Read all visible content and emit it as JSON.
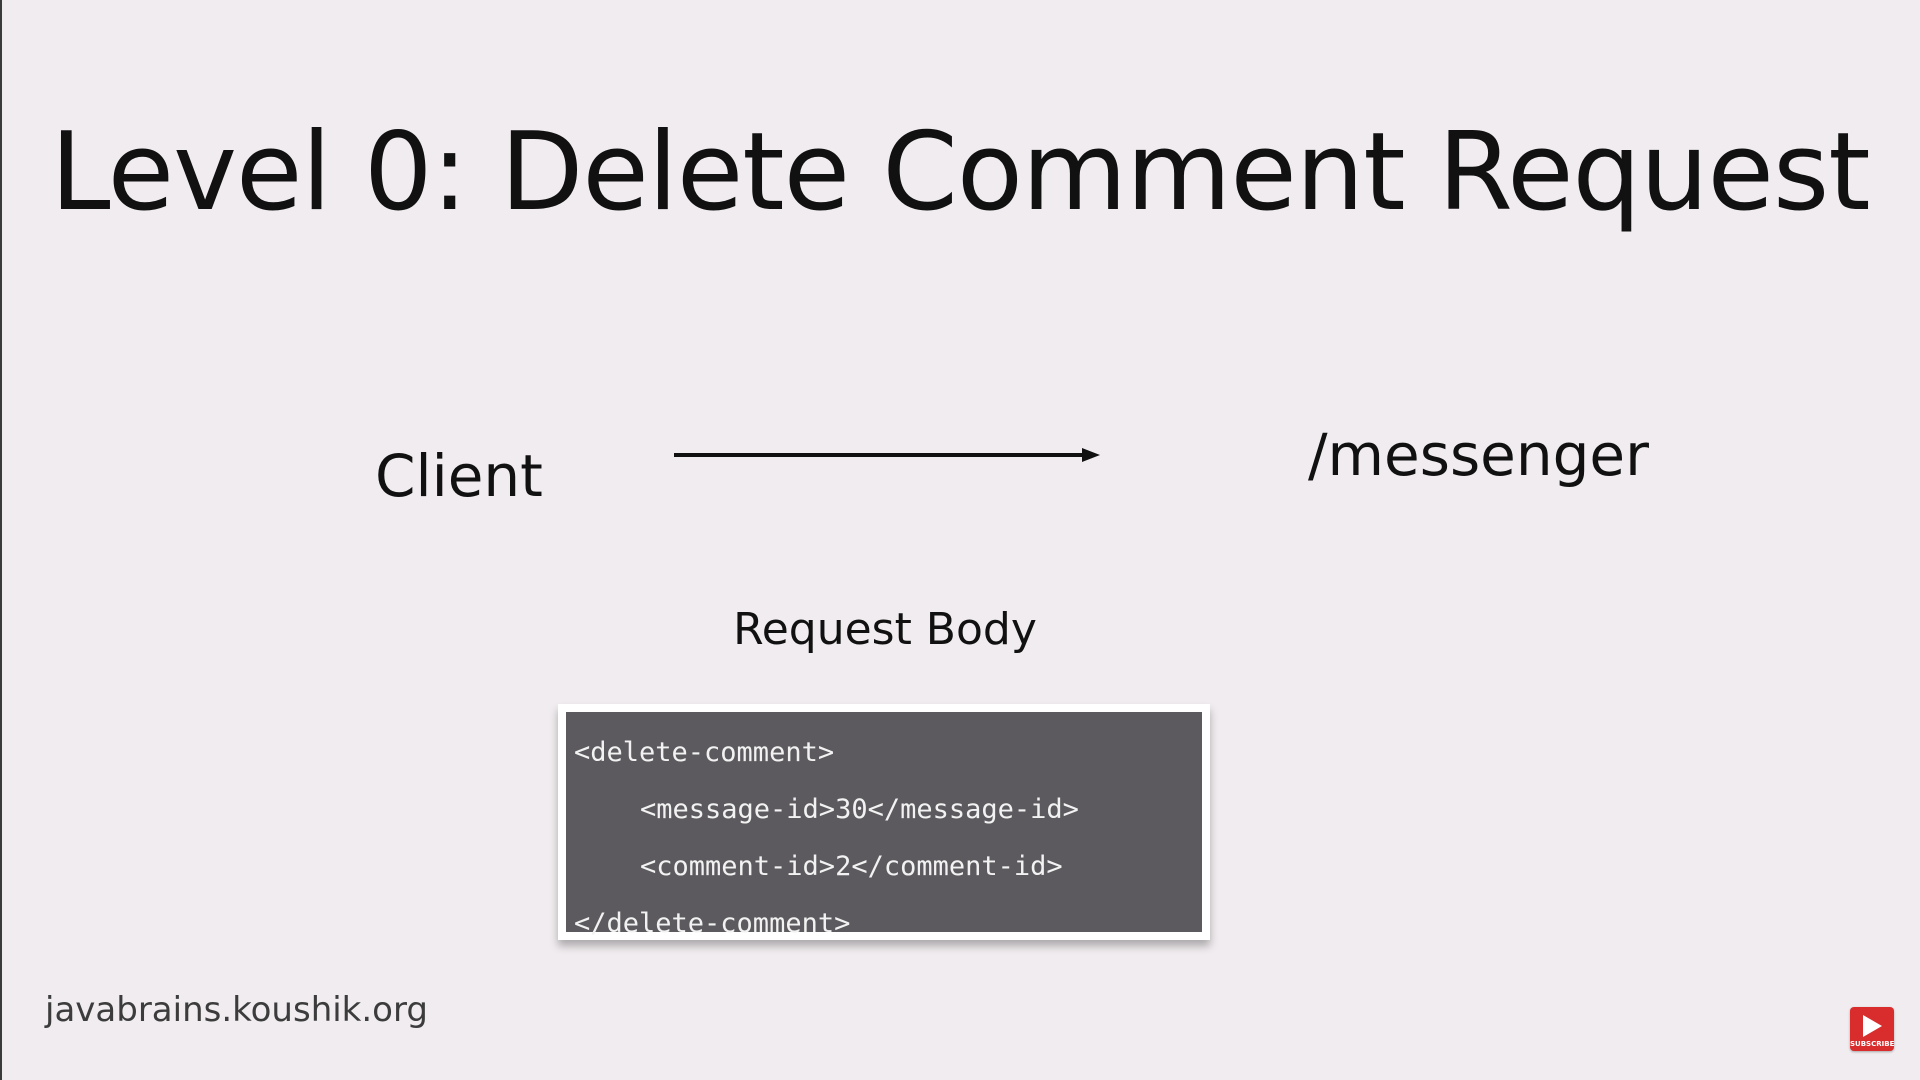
{
  "slide": {
    "title": "Level 0: Delete Comment Request",
    "client_label": "Client",
    "endpoint_label": "/messenger",
    "request_body_label": "Request Body",
    "code_lines": [
      "<delete-comment>",
      "<message-id>30</message-id>",
      "<comment-id>2</comment-id>",
      "</delete-comment>"
    ],
    "footer_url": "javabrains.koushik.org"
  },
  "subscribe_button": {
    "label": "SUBSCRIBE",
    "icon": "play-icon"
  },
  "colors": {
    "background": "#f0ecef",
    "text": "#111111",
    "code_background": "#5c5a5e",
    "code_text": "#f2f2f2",
    "subscribe_red": "#d92c2c"
  }
}
